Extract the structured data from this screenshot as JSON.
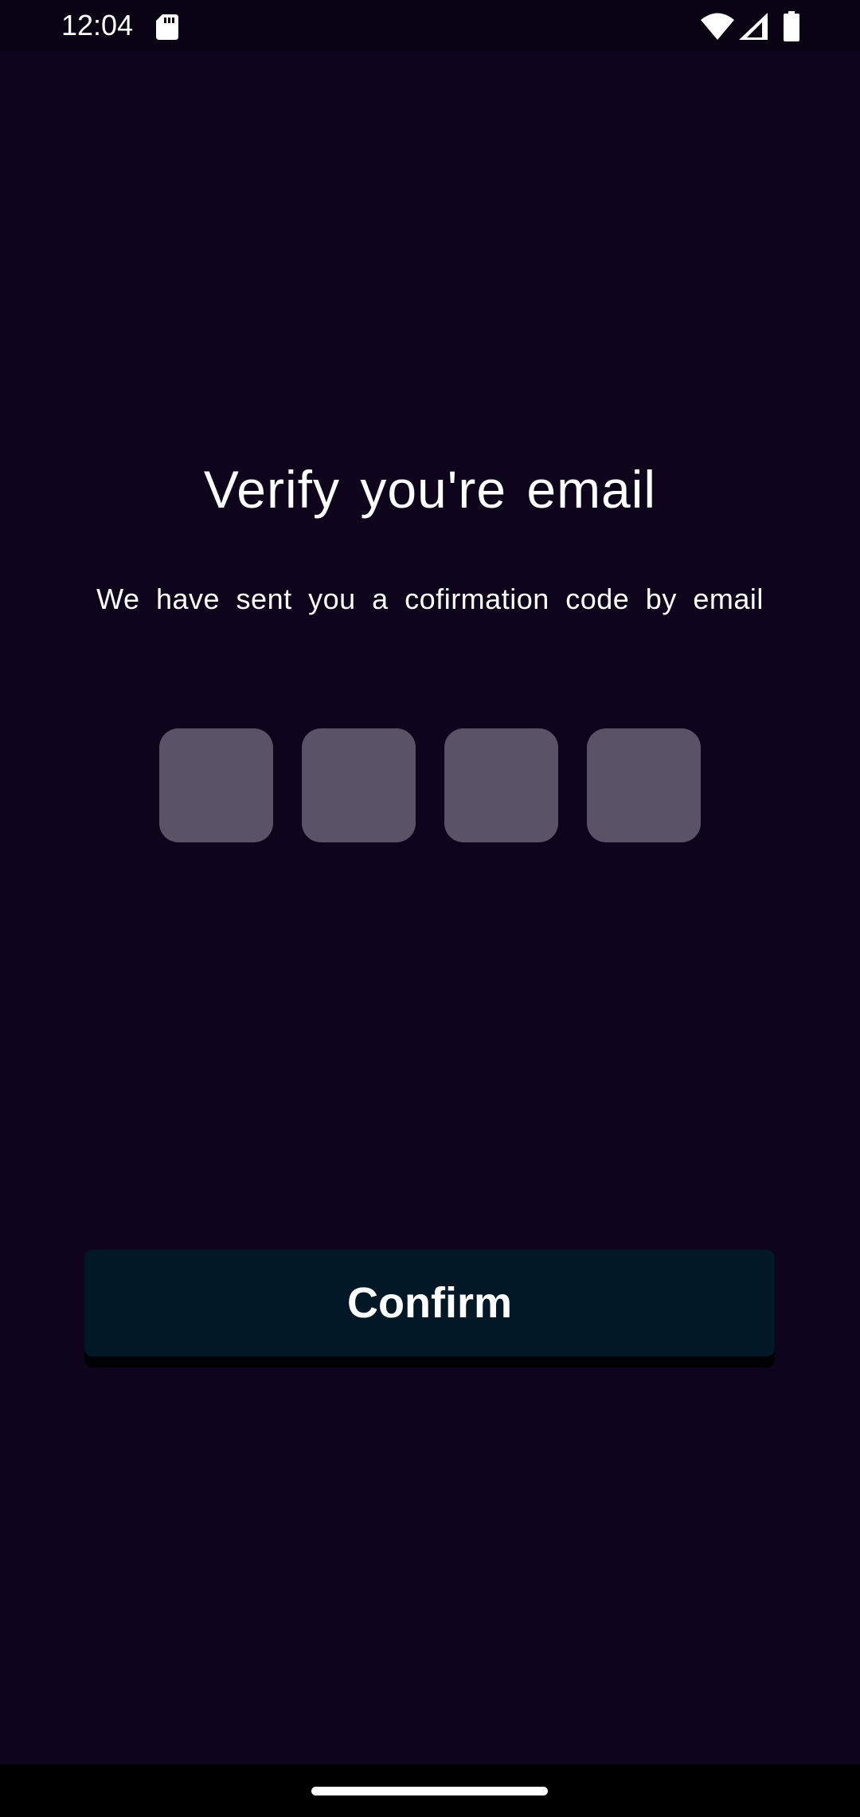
{
  "status_bar": {
    "time": "12:04",
    "icons": [
      "sd-card-icon",
      "wifi-icon",
      "signal-icon",
      "battery-icon"
    ]
  },
  "main": {
    "title": "Verify you're email",
    "subtitle": "We have sent you a cofirmation code by email",
    "code_inputs": [
      {
        "value": ""
      },
      {
        "value": ""
      },
      {
        "value": ""
      },
      {
        "value": ""
      }
    ],
    "confirm_label": "Confirm"
  },
  "colors": {
    "background": "#0e041c",
    "code_box": "#5a5266",
    "button": "#021826",
    "text": "#ffffff"
  }
}
